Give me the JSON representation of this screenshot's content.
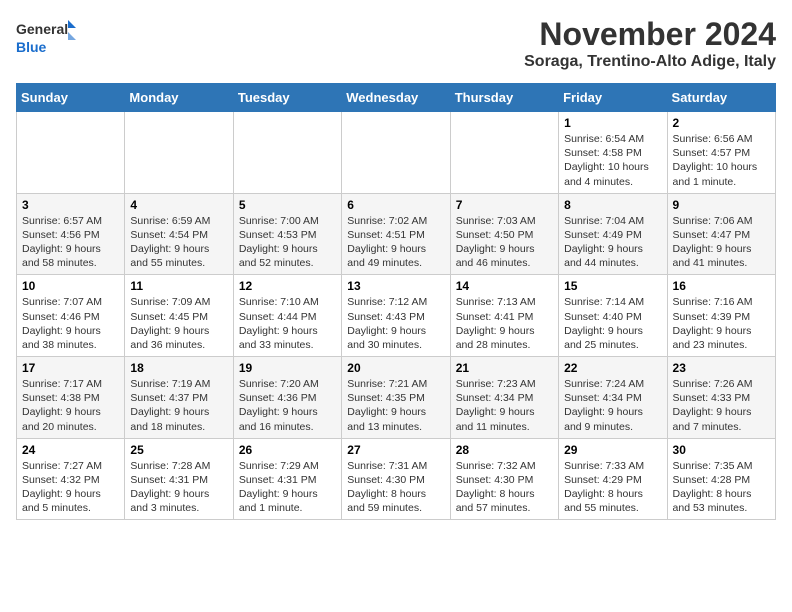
{
  "header": {
    "logo_general": "General",
    "logo_blue": "Blue",
    "month": "November 2024",
    "location": "Soraga, Trentino-Alto Adige, Italy"
  },
  "weekdays": [
    "Sunday",
    "Monday",
    "Tuesday",
    "Wednesday",
    "Thursday",
    "Friday",
    "Saturday"
  ],
  "weeks": [
    [
      {
        "day": "",
        "sunrise": "",
        "sunset": "",
        "daylight": ""
      },
      {
        "day": "",
        "sunrise": "",
        "sunset": "",
        "daylight": ""
      },
      {
        "day": "",
        "sunrise": "",
        "sunset": "",
        "daylight": ""
      },
      {
        "day": "",
        "sunrise": "",
        "sunset": "",
        "daylight": ""
      },
      {
        "day": "",
        "sunrise": "",
        "sunset": "",
        "daylight": ""
      },
      {
        "day": "1",
        "sunrise": "Sunrise: 6:54 AM",
        "sunset": "Sunset: 4:58 PM",
        "daylight": "Daylight: 10 hours and 4 minutes."
      },
      {
        "day": "2",
        "sunrise": "Sunrise: 6:56 AM",
        "sunset": "Sunset: 4:57 PM",
        "daylight": "Daylight: 10 hours and 1 minute."
      }
    ],
    [
      {
        "day": "3",
        "sunrise": "Sunrise: 6:57 AM",
        "sunset": "Sunset: 4:56 PM",
        "daylight": "Daylight: 9 hours and 58 minutes."
      },
      {
        "day": "4",
        "sunrise": "Sunrise: 6:59 AM",
        "sunset": "Sunset: 4:54 PM",
        "daylight": "Daylight: 9 hours and 55 minutes."
      },
      {
        "day": "5",
        "sunrise": "Sunrise: 7:00 AM",
        "sunset": "Sunset: 4:53 PM",
        "daylight": "Daylight: 9 hours and 52 minutes."
      },
      {
        "day": "6",
        "sunrise": "Sunrise: 7:02 AM",
        "sunset": "Sunset: 4:51 PM",
        "daylight": "Daylight: 9 hours and 49 minutes."
      },
      {
        "day": "7",
        "sunrise": "Sunrise: 7:03 AM",
        "sunset": "Sunset: 4:50 PM",
        "daylight": "Daylight: 9 hours and 46 minutes."
      },
      {
        "day": "8",
        "sunrise": "Sunrise: 7:04 AM",
        "sunset": "Sunset: 4:49 PM",
        "daylight": "Daylight: 9 hours and 44 minutes."
      },
      {
        "day": "9",
        "sunrise": "Sunrise: 7:06 AM",
        "sunset": "Sunset: 4:47 PM",
        "daylight": "Daylight: 9 hours and 41 minutes."
      }
    ],
    [
      {
        "day": "10",
        "sunrise": "Sunrise: 7:07 AM",
        "sunset": "Sunset: 4:46 PM",
        "daylight": "Daylight: 9 hours and 38 minutes."
      },
      {
        "day": "11",
        "sunrise": "Sunrise: 7:09 AM",
        "sunset": "Sunset: 4:45 PM",
        "daylight": "Daylight: 9 hours and 36 minutes."
      },
      {
        "day": "12",
        "sunrise": "Sunrise: 7:10 AM",
        "sunset": "Sunset: 4:44 PM",
        "daylight": "Daylight: 9 hours and 33 minutes."
      },
      {
        "day": "13",
        "sunrise": "Sunrise: 7:12 AM",
        "sunset": "Sunset: 4:43 PM",
        "daylight": "Daylight: 9 hours and 30 minutes."
      },
      {
        "day": "14",
        "sunrise": "Sunrise: 7:13 AM",
        "sunset": "Sunset: 4:41 PM",
        "daylight": "Daylight: 9 hours and 28 minutes."
      },
      {
        "day": "15",
        "sunrise": "Sunrise: 7:14 AM",
        "sunset": "Sunset: 4:40 PM",
        "daylight": "Daylight: 9 hours and 25 minutes."
      },
      {
        "day": "16",
        "sunrise": "Sunrise: 7:16 AM",
        "sunset": "Sunset: 4:39 PM",
        "daylight": "Daylight: 9 hours and 23 minutes."
      }
    ],
    [
      {
        "day": "17",
        "sunrise": "Sunrise: 7:17 AM",
        "sunset": "Sunset: 4:38 PM",
        "daylight": "Daylight: 9 hours and 20 minutes."
      },
      {
        "day": "18",
        "sunrise": "Sunrise: 7:19 AM",
        "sunset": "Sunset: 4:37 PM",
        "daylight": "Daylight: 9 hours and 18 minutes."
      },
      {
        "day": "19",
        "sunrise": "Sunrise: 7:20 AM",
        "sunset": "Sunset: 4:36 PM",
        "daylight": "Daylight: 9 hours and 16 minutes."
      },
      {
        "day": "20",
        "sunrise": "Sunrise: 7:21 AM",
        "sunset": "Sunset: 4:35 PM",
        "daylight": "Daylight: 9 hours and 13 minutes."
      },
      {
        "day": "21",
        "sunrise": "Sunrise: 7:23 AM",
        "sunset": "Sunset: 4:34 PM",
        "daylight": "Daylight: 9 hours and 11 minutes."
      },
      {
        "day": "22",
        "sunrise": "Sunrise: 7:24 AM",
        "sunset": "Sunset: 4:34 PM",
        "daylight": "Daylight: 9 hours and 9 minutes."
      },
      {
        "day": "23",
        "sunrise": "Sunrise: 7:26 AM",
        "sunset": "Sunset: 4:33 PM",
        "daylight": "Daylight: 9 hours and 7 minutes."
      }
    ],
    [
      {
        "day": "24",
        "sunrise": "Sunrise: 7:27 AM",
        "sunset": "Sunset: 4:32 PM",
        "daylight": "Daylight: 9 hours and 5 minutes."
      },
      {
        "day": "25",
        "sunrise": "Sunrise: 7:28 AM",
        "sunset": "Sunset: 4:31 PM",
        "daylight": "Daylight: 9 hours and 3 minutes."
      },
      {
        "day": "26",
        "sunrise": "Sunrise: 7:29 AM",
        "sunset": "Sunset: 4:31 PM",
        "daylight": "Daylight: 9 hours and 1 minute."
      },
      {
        "day": "27",
        "sunrise": "Sunrise: 7:31 AM",
        "sunset": "Sunset: 4:30 PM",
        "daylight": "Daylight: 8 hours and 59 minutes."
      },
      {
        "day": "28",
        "sunrise": "Sunrise: 7:32 AM",
        "sunset": "Sunset: 4:30 PM",
        "daylight": "Daylight: 8 hours and 57 minutes."
      },
      {
        "day": "29",
        "sunrise": "Sunrise: 7:33 AM",
        "sunset": "Sunset: 4:29 PM",
        "daylight": "Daylight: 8 hours and 55 minutes."
      },
      {
        "day": "30",
        "sunrise": "Sunrise: 7:35 AM",
        "sunset": "Sunset: 4:28 PM",
        "daylight": "Daylight: 8 hours and 53 minutes."
      }
    ]
  ]
}
